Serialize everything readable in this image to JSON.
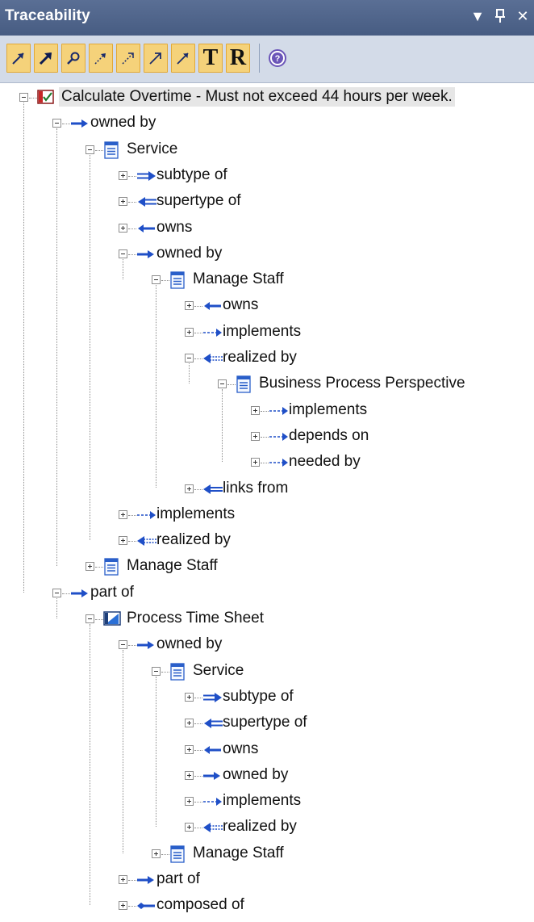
{
  "window": {
    "title": "Traceability",
    "controls": [
      "dropdown",
      "pin",
      "close"
    ]
  },
  "toolbar": {
    "buttons": [
      {
        "icon": "trace-arrow-icon"
      },
      {
        "icon": "trace-arrow-bold-icon"
      },
      {
        "icon": "trace-search-icon"
      },
      {
        "icon": "trace-dotted-arrow-icon"
      },
      {
        "icon": "trace-dotted-arrow-alt-icon"
      },
      {
        "icon": "trace-arrow-thin-icon"
      },
      {
        "icon": "trace-arrow-thin-alt-icon"
      },
      {
        "label": "T"
      },
      {
        "label": "R"
      }
    ],
    "help_icon": "help-icon"
  },
  "tree": {
    "nodes": [
      {
        "label": "Calculate Overtime - Must not exceed 44 hours per week.",
        "icon": "requirement-icon",
        "depth": 0,
        "expanded": true
      },
      {
        "label": "owned by",
        "icon": "owned-by-icon",
        "depth": 1,
        "expanded": true
      },
      {
        "label": "Service",
        "icon": "element-icon",
        "depth": 2,
        "expanded": true
      },
      {
        "label": "subtype of",
        "icon": "subtype-of-icon",
        "depth": 3,
        "expanded": false
      },
      {
        "label": "supertype of",
        "icon": "supertype-of-icon",
        "depth": 3,
        "expanded": false
      },
      {
        "label": "owns",
        "icon": "owns-icon",
        "depth": 3,
        "expanded": false
      },
      {
        "label": "owned by",
        "icon": "owned-by-icon",
        "depth": 3,
        "expanded": true
      },
      {
        "label": "Manage Staff",
        "icon": "element-icon",
        "depth": 4,
        "expanded": true
      },
      {
        "label": "owns",
        "icon": "owns-icon",
        "depth": 5,
        "expanded": false
      },
      {
        "label": "implements",
        "icon": "implements-icon",
        "depth": 5,
        "expanded": false
      },
      {
        "label": "realized by",
        "icon": "realized-by-icon",
        "depth": 5,
        "expanded": true
      },
      {
        "label": "Business Process Perspective",
        "icon": "element-icon",
        "depth": 6,
        "expanded": true
      },
      {
        "label": "implements",
        "icon": "implements-icon",
        "depth": 7,
        "expanded": false
      },
      {
        "label": "depends on",
        "icon": "depends-on-icon",
        "depth": 7,
        "expanded": false
      },
      {
        "label": "needed by",
        "icon": "needed-by-icon",
        "depth": 7,
        "expanded": false
      },
      {
        "label": "links from",
        "icon": "links-from-icon",
        "depth": 5,
        "expanded": false
      },
      {
        "label": "implements",
        "icon": "implements-icon",
        "depth": 3,
        "expanded": false
      },
      {
        "label": "realized by",
        "icon": "realized-by-icon",
        "depth": 3,
        "expanded": false
      },
      {
        "label": "Manage Staff",
        "icon": "element-icon",
        "depth": 2,
        "expanded": false
      },
      {
        "label": "part of",
        "icon": "part-of-icon",
        "depth": 1,
        "expanded": true
      },
      {
        "label": "Process Time Sheet",
        "icon": "process-icon",
        "depth": 2,
        "expanded": true
      },
      {
        "label": "owned by",
        "icon": "owned-by-icon",
        "depth": 3,
        "expanded": true
      },
      {
        "label": "Service",
        "icon": "element-icon",
        "depth": 4,
        "expanded": true
      },
      {
        "label": "subtype of",
        "icon": "subtype-of-icon",
        "depth": 5,
        "expanded": false
      },
      {
        "label": "supertype of",
        "icon": "supertype-of-icon",
        "depth": 5,
        "expanded": false
      },
      {
        "label": "owns",
        "icon": "owns-icon",
        "depth": 5,
        "expanded": false
      },
      {
        "label": "owned by",
        "icon": "owned-by-icon",
        "depth": 5,
        "expanded": false
      },
      {
        "label": "implements",
        "icon": "implements-icon",
        "depth": 5,
        "expanded": false
      },
      {
        "label": "realized by",
        "icon": "realized-by-icon",
        "depth": 5,
        "expanded": false
      },
      {
        "label": "Manage Staff",
        "icon": "element-icon",
        "depth": 4,
        "expanded": false
      },
      {
        "label": "part of",
        "icon": "part-of-icon",
        "depth": 3,
        "expanded": false
      },
      {
        "label": "composed of",
        "icon": "composed-of-icon",
        "depth": 3,
        "expanded": false
      }
    ]
  },
  "colors": {
    "title_bar": "#4d628a",
    "toolbar_bg": "#d3dbe8",
    "button_active": "#f5d27a",
    "arrow_blue": "#1f4fc7",
    "selection": "#e6e6e6"
  }
}
